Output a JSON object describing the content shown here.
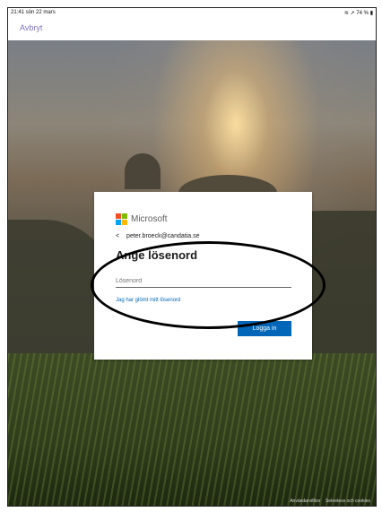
{
  "status_bar": {
    "time": "21:41",
    "date": "sön 22 mars",
    "battery": "74 %"
  },
  "nav": {
    "cancel_label": "Avbryt"
  },
  "dialog": {
    "brand": "Microsoft",
    "account_email": "peter.broeck@candatia.se",
    "heading": "Ange lösenord",
    "password_placeholder": "Lösenord",
    "forgot_link": "Jag har glömt mitt lösenord",
    "signin_label": "Logga in"
  },
  "footer": {
    "links": [
      "Användarvillkor",
      "Sekretess och cookies"
    ]
  },
  "colors": {
    "microsoft_red": "#f25022",
    "microsoft_green": "#7fba00",
    "microsoft_blue": "#00a4ef",
    "microsoft_yellow": "#ffb900",
    "primary_button": "#0067b8",
    "cancel_link": "#7e72c8"
  }
}
